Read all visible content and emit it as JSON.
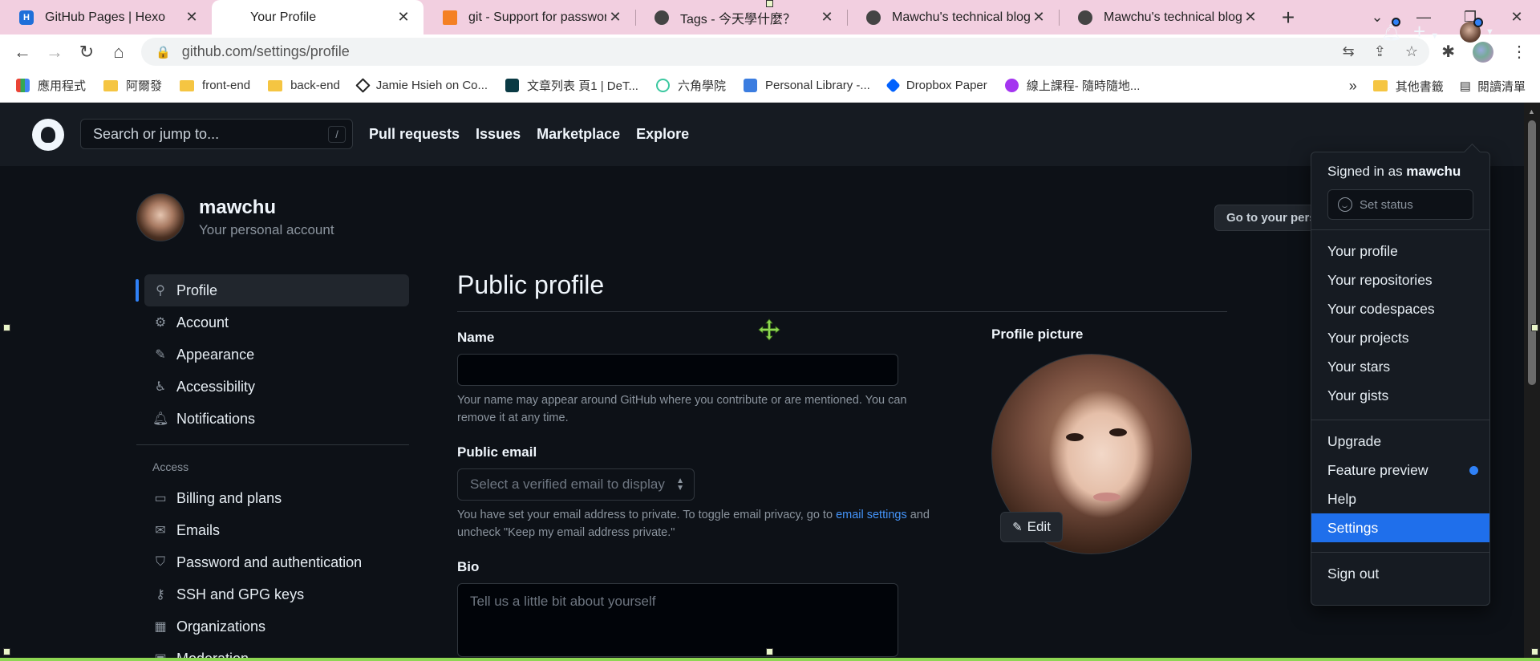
{
  "browser": {
    "tabs": [
      {
        "title": "GitHub Pages | Hexo",
        "favicon": "hexo-icon",
        "color": "#1e6fd9"
      },
      {
        "title": "Your Profile",
        "favicon": "github-icon",
        "color": "#000000"
      },
      {
        "title": "git - Support for passwor",
        "favicon": "stackoverflow-icon",
        "color": "#f48024"
      },
      {
        "title": "Tags - 今天學什麼？",
        "favicon": "globe-icon",
        "color": "#444444"
      },
      {
        "title": "Mawchu's technical blog",
        "favicon": "globe-icon",
        "color": "#444444"
      },
      {
        "title": "Mawchu's technical blog",
        "favicon": "globe-icon",
        "color": "#444444"
      }
    ],
    "active_tab": 1,
    "url": "github.com/settings/profile",
    "bookmarks": [
      {
        "label": "應用程式",
        "icon": "apps-grid-icon"
      },
      {
        "label": "阿爾發",
        "icon": "folder-icon"
      },
      {
        "label": "front-end",
        "icon": "folder-icon"
      },
      {
        "label": "back-end",
        "icon": "folder-icon"
      },
      {
        "label": "Jamie Hsieh on Co...",
        "icon": "codepen-icon"
      },
      {
        "label": "文章列表 頁1 | DeT...",
        "icon": "detail-icon"
      },
      {
        "label": "六角學院",
        "icon": "hexschool-icon"
      },
      {
        "label": "Personal Library -...",
        "icon": "library-icon"
      },
      {
        "label": "Dropbox Paper",
        "icon": "dropbox-icon"
      },
      {
        "label": "線上課程- 隨時隨地...",
        "icon": "course-icon"
      }
    ],
    "bookmarks_overflow": "»",
    "other_bookmarks": "其他書籤",
    "reading_list": "閱讀清單"
  },
  "github": {
    "search_placeholder": "Search or jump to...",
    "search_shortcut": "/",
    "nav": [
      "Pull requests",
      "Issues",
      "Marketplace",
      "Explore"
    ]
  },
  "account": {
    "username": "mawchu",
    "subtitle": "Your personal account",
    "goto_button": "Go to your personal profile"
  },
  "sidebar": {
    "items": [
      {
        "label": "Profile",
        "icon": "person-icon"
      },
      {
        "label": "Account",
        "icon": "gear-icon"
      },
      {
        "label": "Appearance",
        "icon": "paintbrush-icon"
      },
      {
        "label": "Accessibility",
        "icon": "accessibility-icon"
      },
      {
        "label": "Notifications",
        "icon": "bell-icon"
      }
    ],
    "access_heading": "Access",
    "access_items": [
      {
        "label": "Billing and plans",
        "icon": "credit-card-icon"
      },
      {
        "label": "Emails",
        "icon": "mail-icon"
      },
      {
        "label": "Password and authentication",
        "icon": "shield-lock-icon"
      },
      {
        "label": "SSH and GPG keys",
        "icon": "key-icon"
      },
      {
        "label": "Organizations",
        "icon": "organization-icon"
      },
      {
        "label": "Moderation",
        "icon": "report-icon"
      }
    ]
  },
  "profile": {
    "title": "Public profile",
    "name_label": "Name",
    "name_value": "",
    "name_help": "Your name may appear around GitHub where you contribute or are mentioned. You can remove it at any time.",
    "email_label": "Public email",
    "email_placeholder": "Select a verified email to display",
    "email_help_before": "You have set your email address to private. To toggle email privacy, go to ",
    "email_help_link": "email settings",
    "email_help_after": " and uncheck \"Keep my email address private.\"",
    "bio_label": "Bio",
    "bio_placeholder": "Tell us a little bit about yourself",
    "picture_label": "Profile picture",
    "edit_label": "Edit"
  },
  "menu": {
    "signed_in_prefix": "Signed in as ",
    "signed_in_user": "mawchu",
    "set_status": "Set status",
    "group1": [
      "Your profile",
      "Your repositories",
      "Your codespaces",
      "Your projects",
      "Your stars",
      "Your gists"
    ],
    "group2": [
      "Upgrade",
      "Feature preview",
      "Help",
      "Settings"
    ],
    "active_item": "Settings",
    "sign_out": "Sign out"
  },
  "colors": {
    "accent": "#2f81f7",
    "menu_active": "#1f6feb",
    "page_bg": "#0d1117",
    "header_bg": "#161b22",
    "tabbar_bg": "#f2cfe0"
  }
}
